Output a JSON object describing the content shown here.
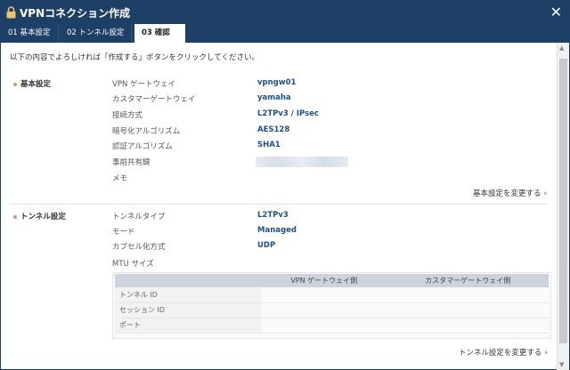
{
  "window": {
    "title": "VPNコネクション作成",
    "close_label": "✕"
  },
  "tabs": [
    {
      "label": "01 基本設定",
      "active": false
    },
    {
      "label": "02 トンネル設定",
      "active": false
    },
    {
      "label": "03 確認",
      "active": true
    }
  ],
  "intro": "以下の内容でよろしければ「作成する」ボタンをクリックしてください。",
  "basic": {
    "heading": "基本設定",
    "rows": [
      {
        "label": "VPN ゲートウェイ",
        "value": "vpngw01"
      },
      {
        "label": "カスタマーゲートウェイ",
        "value": "yamaha"
      },
      {
        "label": "接続方式",
        "value": "L2TPv3 / IPsec"
      },
      {
        "label": "暗号化アルゴリズム",
        "value": "AES128"
      },
      {
        "label": "認証アルゴリズム",
        "value": "SHA1"
      },
      {
        "label": "事前共有鍵",
        "value": ""
      },
      {
        "label": "メモ",
        "value": ""
      }
    ],
    "change_link": "基本設定を変更する"
  },
  "tunnel": {
    "heading": "トンネル設定",
    "rows": [
      {
        "label": "トンネルタイプ",
        "value": "L2TPv3"
      },
      {
        "label": "モード",
        "value": "Managed"
      },
      {
        "label": "カプセル化方式",
        "value": "UDP"
      },
      {
        "label": "MTU サイズ",
        "value": ""
      }
    ],
    "table": {
      "headers": [
        "",
        "VPN ゲートウェイ側",
        "カスタマーゲートウェイ側"
      ],
      "rows": [
        {
          "label": "トンネル ID",
          "vpn": "",
          "customer": ""
        },
        {
          "label": "セッション ID",
          "vpn": "",
          "customer": ""
        },
        {
          "label": "ポート",
          "vpn": "",
          "customer": ""
        }
      ]
    },
    "change_link": "トンネル設定を変更する"
  },
  "chevron": "›"
}
